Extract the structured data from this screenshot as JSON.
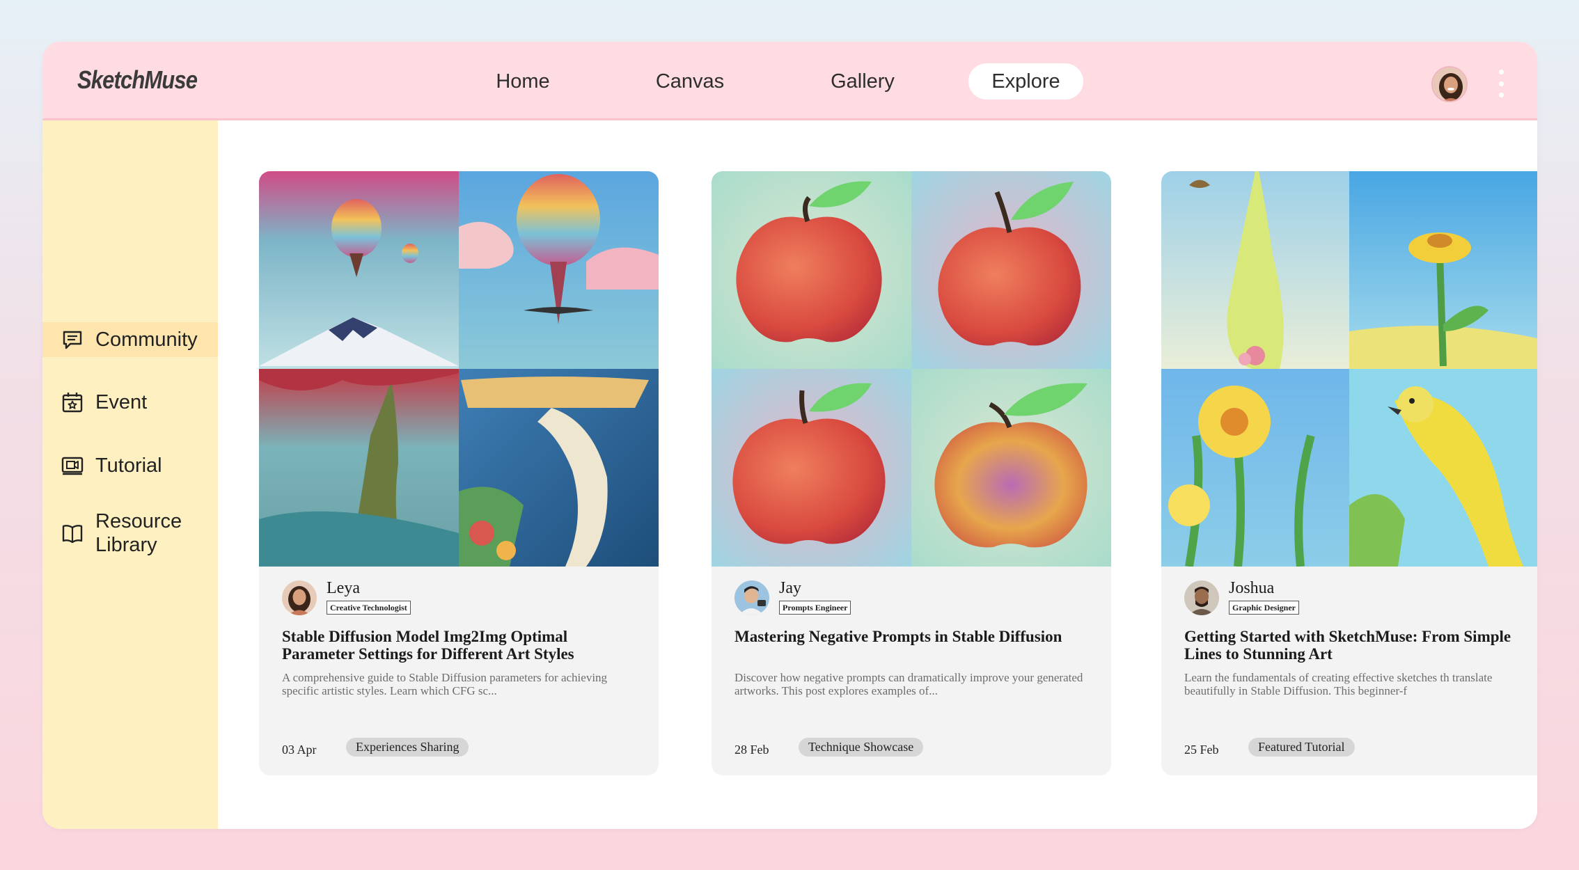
{
  "app": {
    "logo": "SketchMuse"
  },
  "nav": {
    "items": [
      {
        "label": "Home"
      },
      {
        "label": "Canvas"
      },
      {
        "label": "Gallery"
      },
      {
        "label": "Explore",
        "active": true
      }
    ]
  },
  "sidebar": {
    "items": [
      {
        "label": "Community",
        "icon": "chat-bubble-icon",
        "active": true
      },
      {
        "label": "Event",
        "icon": "calendar-star-icon"
      },
      {
        "label": "Tutorial",
        "icon": "video-icon"
      },
      {
        "label_line1": "Resource",
        "label_line2": "Library",
        "icon": "open-book-icon"
      }
    ]
  },
  "posts": [
    {
      "author": "Leya",
      "role": "Creative Technologist",
      "title": "Stable Diffusion Model Img2Img Optimal Parameter Settings for Different Art Styles",
      "description": "A comprehensive guide to Stable Diffusion parameters for achieving specific artistic styles. Learn which CFG sc...",
      "date": "03 Apr",
      "tag": "Experiences Sharing",
      "art": "surreal-balloons-mountain-collage"
    },
    {
      "author": "Jay",
      "role": "Prompts Engineer",
      "title": "Mastering Negative Prompts in Stable Diffusion",
      "description": "Discover how negative prompts can dramatically improve your generated artworks. This post explores examples of...",
      "date": "28 Feb",
      "tag": "Technique Showcase",
      "art": "four-apples-collage"
    },
    {
      "author": "Joshua",
      "role": "Graphic Designer",
      "title": "Getting Started with SketchMuse: From Simple Lines to Stunning Art",
      "description": "Learn the fundamentals of creating effective sketches th translate beautifully in Stable Diffusion. This beginner-f",
      "date": "25 Feb",
      "tag": "Featured Tutorial",
      "art": "flowers-bird-vase-collage"
    }
  ],
  "colors": {
    "topbar": "#ffdce2",
    "sidebar": "#fff0c2",
    "sidebar_active": "#fde5ad",
    "card": "#f3f3f3",
    "tag": "#d6d6d6"
  }
}
